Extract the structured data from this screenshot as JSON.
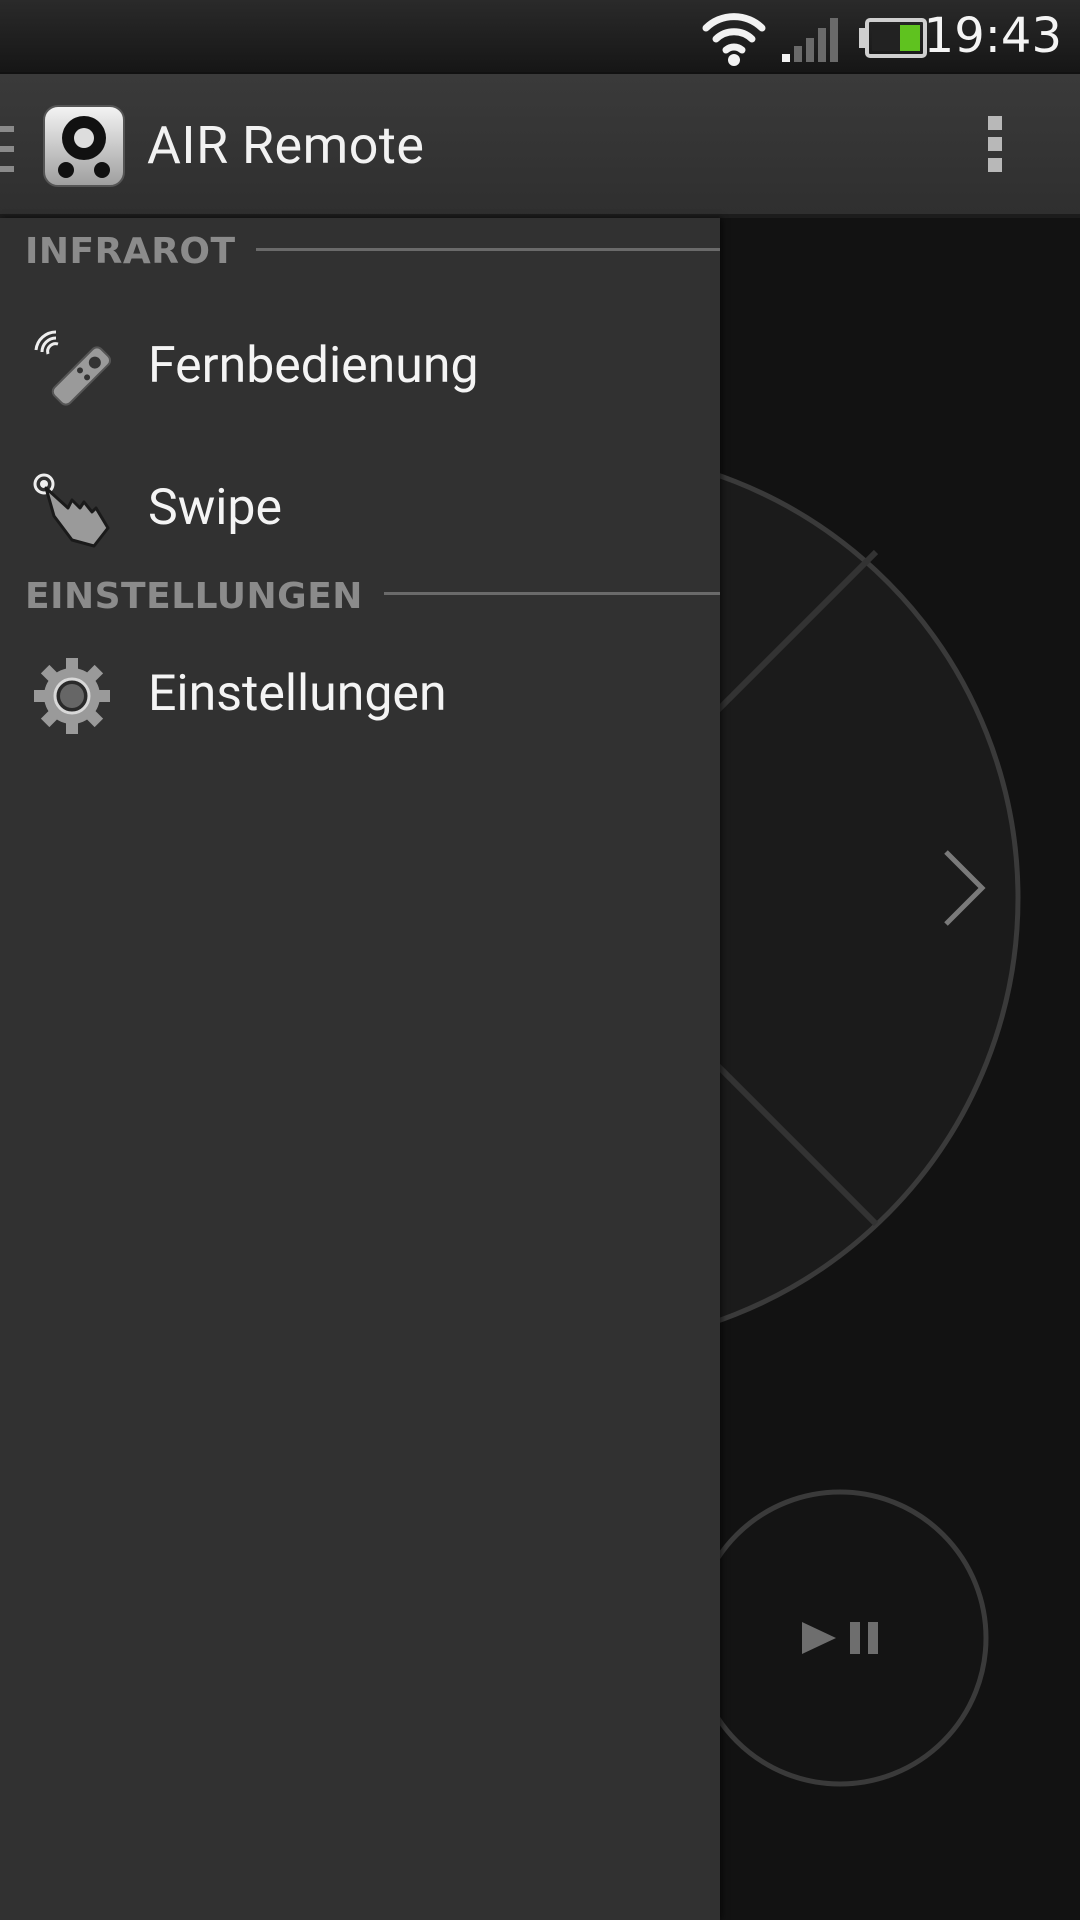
{
  "status_bar": {
    "time": "19:43",
    "icons": [
      "wifi-icon",
      "signal-icon",
      "battery-icon"
    ],
    "battery_color": "#4caf1f"
  },
  "action_bar": {
    "title": "AIR Remote",
    "app_icon": "remote-app-icon",
    "overflow_icon": "overflow-menu-icon"
  },
  "drawer": {
    "sections": [
      {
        "header": "INFRAROT",
        "items": [
          {
            "label": "Fernbedienung",
            "icon": "remote-control-icon"
          },
          {
            "label": "Swipe",
            "icon": "swipe-hand-icon"
          }
        ]
      },
      {
        "header": "EINSTELLUNGEN",
        "items": [
          {
            "label": "Einstellungen",
            "icon": "gear-icon"
          }
        ]
      }
    ]
  },
  "remote": {
    "dpad_right_icon": "chevron-right-icon",
    "play_pause_icon": "play-pause-icon"
  },
  "colors": {
    "drawer_bg": "#313131",
    "section_header": "#8b8b8b",
    "background": "#121212"
  }
}
